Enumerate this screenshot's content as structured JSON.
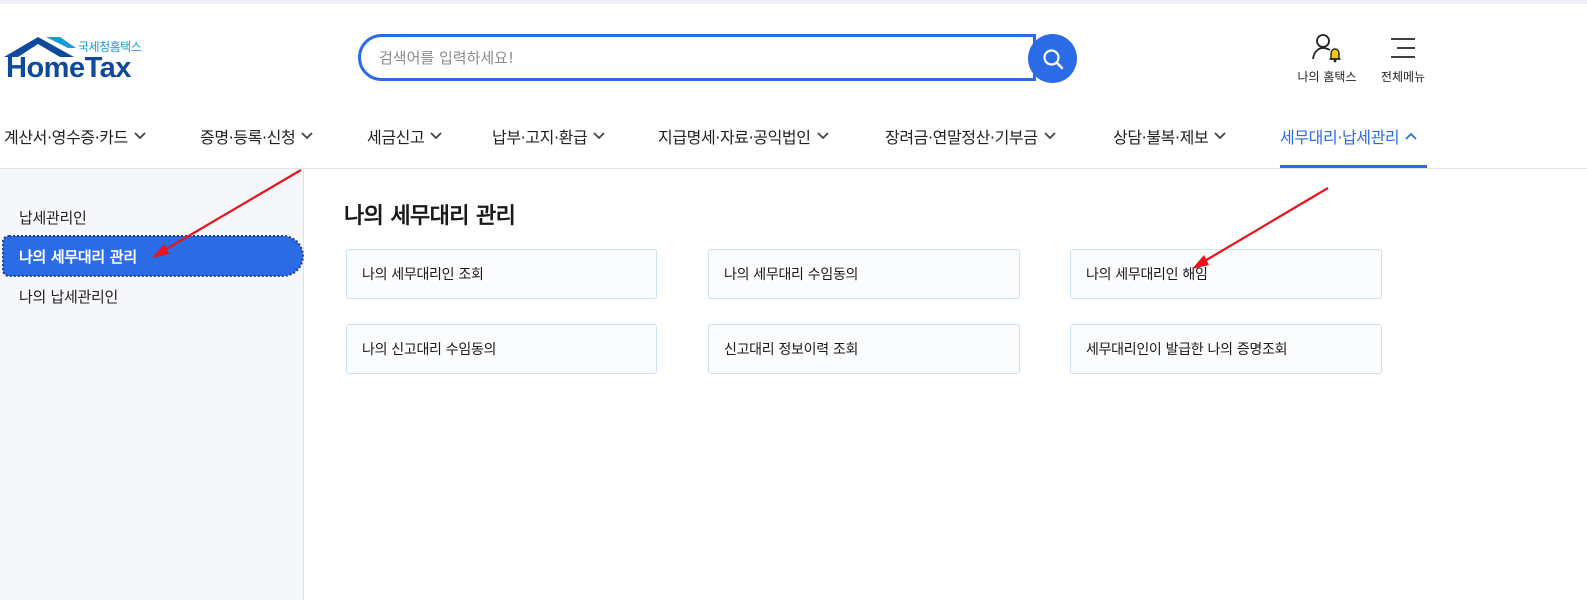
{
  "logo": {
    "sub": "국세청홈택스",
    "main": "HomeTax"
  },
  "search": {
    "placeholder": "검색어를 입력하세요!",
    "value": ""
  },
  "utility": {
    "my_hometax": "나의 홈택스",
    "all_menu": "전체메뉴"
  },
  "gnb": {
    "items": [
      {
        "label": "계산서·영수증·카드"
      },
      {
        "label": "증명·등록·신청"
      },
      {
        "label": "세금신고"
      },
      {
        "label": "납부·고지·환급"
      },
      {
        "label": "지급명세·자료·공익법인"
      },
      {
        "label": "장려금·연말정산·기부금"
      },
      {
        "label": "상담·불복·제보"
      },
      {
        "label": "세무대리·납세관리",
        "active": true
      }
    ]
  },
  "sidebar": {
    "items": [
      {
        "label": "납세관리인"
      },
      {
        "label": "나의 세무대리 관리",
        "active": true
      },
      {
        "label": "나의 납세관리인"
      }
    ]
  },
  "content": {
    "title": "나의 세무대리 관리",
    "cards": [
      {
        "label": "나의 세무대리인 조회"
      },
      {
        "label": "나의 세무대리 수임동의"
      },
      {
        "label": "나의 세무대리인 해임"
      },
      {
        "label": "나의 신고대리 수임동의"
      },
      {
        "label": "신고대리 정보이력 조회"
      },
      {
        "label": "세무대리인이 발급한 나의 증명조회"
      }
    ]
  },
  "colors": {
    "accent": "#2b6be6",
    "logo_blue": "#0d4a9a",
    "annotation": "#e8141b"
  }
}
